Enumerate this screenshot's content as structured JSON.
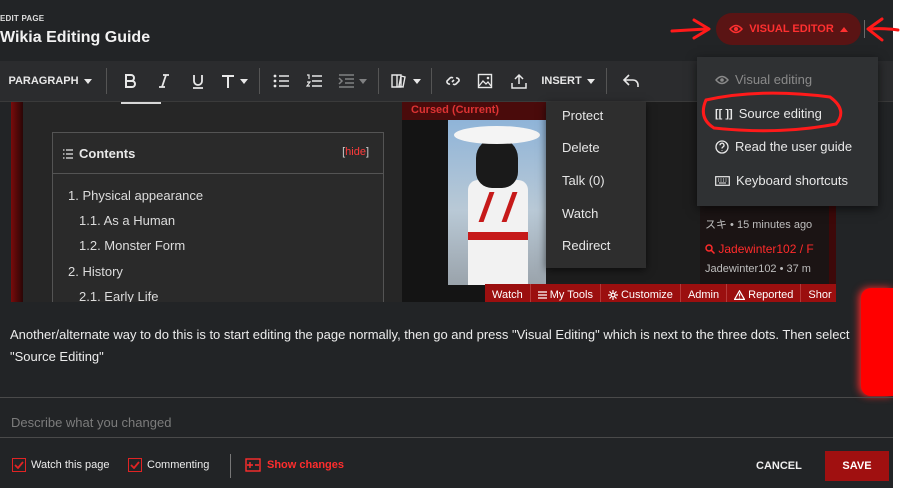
{
  "header": {
    "subtitle": "EDIT PAGE",
    "title": "Wikia Editing Guide"
  },
  "editor_button": {
    "label": "VISUAL EDITOR",
    "icon": "eye-icon"
  },
  "toolbar": {
    "paragraph": "PARAGRAPH",
    "insert": "INSERT",
    "icons": [
      "bold-icon",
      "italic-icon",
      "underline-icon",
      "text-style-icon",
      "bullet-list-icon",
      "numbered-list-icon",
      "indent-icon",
      "cite-icon",
      "link-icon",
      "image-icon",
      "upload-icon",
      "undo-icon"
    ]
  },
  "editor_menu": {
    "items": [
      {
        "label": "Visual editing",
        "icon": "eye-icon",
        "active": false
      },
      {
        "label": "Source editing",
        "icon": "source-brackets-icon",
        "active": true
      },
      {
        "label": "Read the user guide",
        "icon": "help-icon",
        "active": true
      },
      {
        "label": "Keyboard shortcuts",
        "icon": "keyboard-icon",
        "active": true
      }
    ]
  },
  "preview": {
    "tab_label": "Cursed (Current)",
    "toc": {
      "title": "Contents",
      "hide_left": "[",
      "hide_link": "hide",
      "hide_right": "]",
      "items": [
        "1. Physical appearance",
        "1.1. As a Human",
        "1.2. Monster Form",
        "2. History",
        "2.1. Early Life"
      ]
    },
    "context_menu": [
      "Protect",
      "Delete",
      "Talk (0)",
      "Watch",
      "Redirect"
    ],
    "recent_changes": [
      {
        "user_time": "スキ • 15 minutes ago"
      },
      {
        "title": "Jadewinter102 / F"
      },
      {
        "user_time": "Jadewinter102 • 37 m"
      }
    ],
    "bottom_bar": [
      "Watch",
      "My Tools",
      "Customize",
      "Admin",
      "Reported",
      "Shor"
    ]
  },
  "body_text": "Another/alternate way to do this is to start editing the page normally, then go and press \"Visual Editing\" which is next to the three dots. Then select \"Source Editing\"",
  "summary_placeholder": "Describe what you changed",
  "footer": {
    "watch_label": "Watch this page",
    "commenting_label": "Commenting",
    "show_changes": "Show changes",
    "cancel": "CANCEL",
    "save": "SAVE"
  },
  "colors": {
    "accent": "#ff2424",
    "background": "#222426",
    "save": "#a01010"
  }
}
